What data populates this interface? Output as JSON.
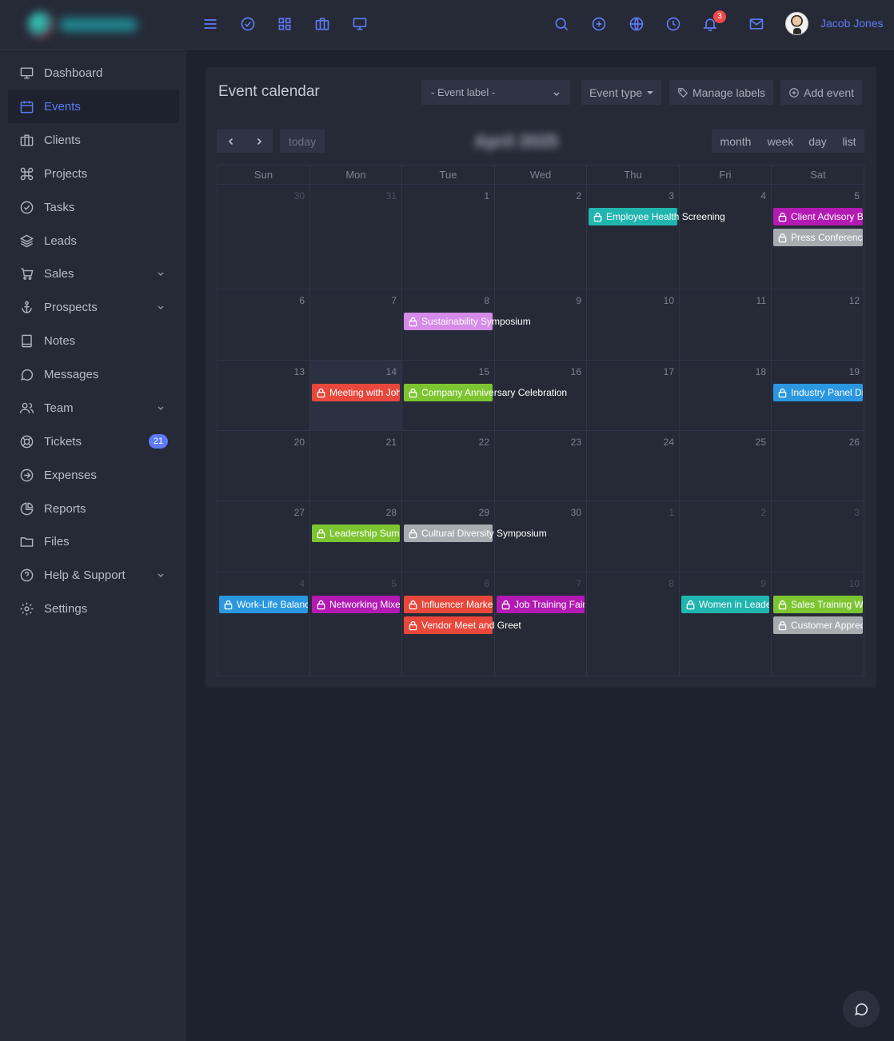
{
  "user": {
    "name": "Jacob Jones"
  },
  "notifications": {
    "count": "3"
  },
  "sidebar": {
    "items": [
      {
        "label": "Dashboard",
        "icon": "monitor-icon"
      },
      {
        "label": "Events",
        "icon": "calendar-icon",
        "active": true
      },
      {
        "label": "Clients",
        "icon": "briefcase-icon"
      },
      {
        "label": "Projects",
        "icon": "command-icon"
      },
      {
        "label": "Tasks",
        "icon": "check-circle-icon"
      },
      {
        "label": "Leads",
        "icon": "layers-icon"
      },
      {
        "label": "Sales",
        "icon": "cart-icon",
        "submenu": true
      },
      {
        "label": "Prospects",
        "icon": "anchor-icon",
        "submenu": true
      },
      {
        "label": "Notes",
        "icon": "book-icon"
      },
      {
        "label": "Messages",
        "icon": "chat-icon"
      },
      {
        "label": "Team",
        "icon": "users-icon",
        "submenu": true
      },
      {
        "label": "Tickets",
        "icon": "lifebuoy-icon",
        "badge": "21"
      },
      {
        "label": "Expenses",
        "icon": "arrow-circle-icon"
      },
      {
        "label": "Reports",
        "icon": "pie-chart-icon"
      },
      {
        "label": "Files",
        "icon": "folder-icon"
      },
      {
        "label": "Help & Support",
        "icon": "help-icon",
        "submenu": true
      },
      {
        "label": "Settings",
        "icon": "gear-icon"
      }
    ]
  },
  "card": {
    "title": "Event calendar",
    "label_select": "- Event label -",
    "event_type": "Event type",
    "manage_labels": "Manage labels",
    "add_event": "Add event"
  },
  "calendar": {
    "today_label": "today",
    "title": "April 2025",
    "views": [
      "month",
      "week",
      "day",
      "list"
    ],
    "weekdays": [
      "Sun",
      "Mon",
      "Tue",
      "Wed",
      "Thu",
      "Fri",
      "Sat"
    ],
    "weeks": [
      [
        "30",
        "31",
        "1",
        "2",
        "3",
        "4",
        "5"
      ],
      [
        "6",
        "7",
        "8",
        "9",
        "10",
        "11",
        "12"
      ],
      [
        "13",
        "14",
        "15",
        "16",
        "17",
        "18",
        "19"
      ],
      [
        "20",
        "21",
        "22",
        "23",
        "24",
        "25",
        "26"
      ],
      [
        "27",
        "28",
        "29",
        "30",
        "1",
        "2",
        "3"
      ],
      [
        "4",
        "5",
        "6",
        "7",
        "8",
        "9",
        "10"
      ]
    ],
    "events": [
      {
        "title": "Employee Health Screening",
        "week": 0,
        "day": 4,
        "slot": 0,
        "color": "#21b5b0",
        "overflow": true
      },
      {
        "title": "Client Advisory Board",
        "week": 0,
        "day": 6,
        "slot": 0,
        "color": "#b319b3"
      },
      {
        "title": "Press Conference",
        "week": 0,
        "day": 6,
        "slot": 1,
        "color": "#a7acb1"
      },
      {
        "title": "Sustainability Symposium",
        "week": 1,
        "day": 2,
        "slot": 0,
        "color": "#d58be8",
        "overflow": true
      },
      {
        "title": "Meeting with John",
        "week": 2,
        "day": 1,
        "slot": 0,
        "color": "#e8473b"
      },
      {
        "title": "Company Anniversary Celebration",
        "week": 2,
        "day": 2,
        "slot": 0,
        "color": "#7cc531",
        "overflow": true
      },
      {
        "title": "Industry Panel Discussion",
        "week": 2,
        "day": 6,
        "slot": 0,
        "color": "#2a97e0"
      },
      {
        "title": "Leadership Summit",
        "week": 4,
        "day": 1,
        "slot": 0,
        "color": "#7cc531"
      },
      {
        "title": "Cultural Diversity Symposium",
        "week": 4,
        "day": 2,
        "slot": 0,
        "color": "#a7acb1",
        "overflow": true
      },
      {
        "title": "Work-Life Balance",
        "week": 5,
        "day": 0,
        "slot": 0,
        "color": "#2a97e0"
      },
      {
        "title": "Networking Mixer",
        "week": 5,
        "day": 1,
        "slot": 0,
        "color": "#b319b3"
      },
      {
        "title": "Influencer Marketing",
        "week": 5,
        "day": 2,
        "slot": 0,
        "color": "#e8473b"
      },
      {
        "title": "Job Training Fair",
        "week": 5,
        "day": 3,
        "slot": 0,
        "color": "#b319b3"
      },
      {
        "title": "Vendor Meet and Greet",
        "week": 5,
        "day": 2,
        "slot": 1,
        "color": "#e8473b",
        "overflow": true
      },
      {
        "title": "Women in Leadership",
        "week": 5,
        "day": 5,
        "slot": 0,
        "color": "#21b5b0"
      },
      {
        "title": "Sales Training Workshop",
        "week": 5,
        "day": 6,
        "slot": 0,
        "color": "#7cc531"
      },
      {
        "title": "Customer Appreciation",
        "week": 5,
        "day": 6,
        "slot": 1,
        "color": "#a7acb1"
      }
    ]
  },
  "colors": {
    "accent": "#5c7bf5",
    "background": "#1e222e",
    "panel": "#262a37"
  }
}
